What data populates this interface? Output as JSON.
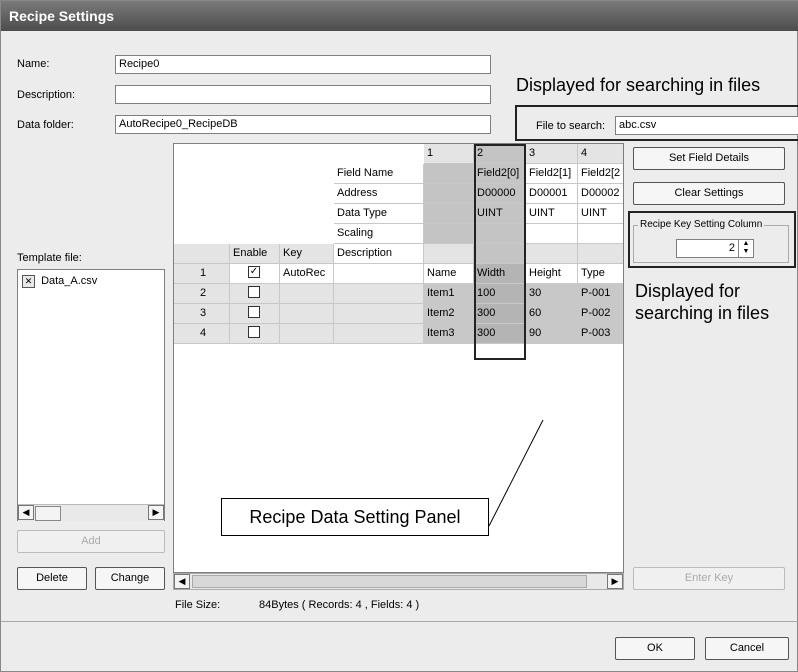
{
  "window": {
    "title": "Recipe Settings"
  },
  "form": {
    "name_label": "Name:",
    "name_value": "Recipe0",
    "description_label": "Description:",
    "description_value": "",
    "data_folder_label": "Data folder:",
    "data_folder_value": "AutoRecipe0_RecipeDB",
    "file_to_search_label": "File to search:",
    "file_to_search_value": "abc.csv",
    "template_file_label": "Template file:"
  },
  "annotations": {
    "top": "Displayed for searching in files",
    "right": "Displayed for searching in files",
    "panel": "Recipe Data Setting Panel"
  },
  "template_files": [
    "Data_A.csv"
  ],
  "left_buttons": {
    "add": "Add",
    "delete": "Delete",
    "change": "Change"
  },
  "right_buttons": {
    "set_field_details": "Set Field Details",
    "clear_settings": "Clear Settings",
    "enter_key": "Enter Key"
  },
  "key_column": {
    "label": "Recipe Key Setting Column",
    "value": "2"
  },
  "grid": {
    "col_numbers": [
      "1",
      "2",
      "3",
      "4"
    ],
    "header_labels": [
      "Field Name",
      "Address",
      "Data Type",
      "Scaling",
      "Description"
    ],
    "field_names": [
      "",
      "Field2[0]",
      "Field2[1]",
      "Field2[2"
    ],
    "addresses": [
      "",
      "D00000",
      "D00001",
      "D00002"
    ],
    "data_types": [
      "",
      "UINT",
      "UINT",
      "UINT"
    ],
    "enable_header": "Enable",
    "key_header": "Key",
    "rows": [
      {
        "num": "1",
        "enabled": true,
        "key": "AutoRec",
        "cells": [
          "Name",
          "Width",
          "Height",
          "Type"
        ]
      },
      {
        "num": "2",
        "enabled": false,
        "key": "",
        "cells": [
          "Item1",
          "100",
          "30",
          "P-001"
        ]
      },
      {
        "num": "3",
        "enabled": false,
        "key": "",
        "cells": [
          "Item2",
          "300",
          "60",
          "P-002"
        ]
      },
      {
        "num": "4",
        "enabled": false,
        "key": "",
        "cells": [
          "Item3",
          "300",
          "90",
          "P-003"
        ]
      }
    ]
  },
  "status": {
    "file_size_label": "File Size:",
    "file_size_value": "84Bytes   ( Records: 4 , Fields: 4 )"
  },
  "dialog_buttons": {
    "ok": "OK",
    "cancel": "Cancel"
  }
}
